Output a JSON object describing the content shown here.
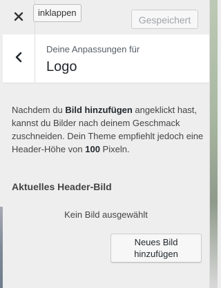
{
  "topbar": {
    "close_icon": "close-icon",
    "collapse_label": "inklappen",
    "saved_label": "Gespeichert"
  },
  "section": {
    "back_icon": "chevron-left-icon",
    "subtitle": "Deine Anpassungen für",
    "title": "Logo"
  },
  "description": {
    "part1": "Nachdem du ",
    "bold1": "Bild hinzufügen",
    "part2": " angeklickt hast, kannst du Bilder nach deinem Geschmack zuschneiden. Dein Theme empfiehlt jedoch eine Header-Höhe von ",
    "bold2": "100",
    "part3": " Pixeln."
  },
  "current_header": {
    "title": "Aktuelles Header-Bild",
    "empty_text": "Kein Bild ausgewählt",
    "add_button": "Neues Bild hinzufügen"
  },
  "colors": {
    "panel_bg": "#eeeeee",
    "header_bg": "#ffffff",
    "saved_text": "#a0a5aa"
  }
}
